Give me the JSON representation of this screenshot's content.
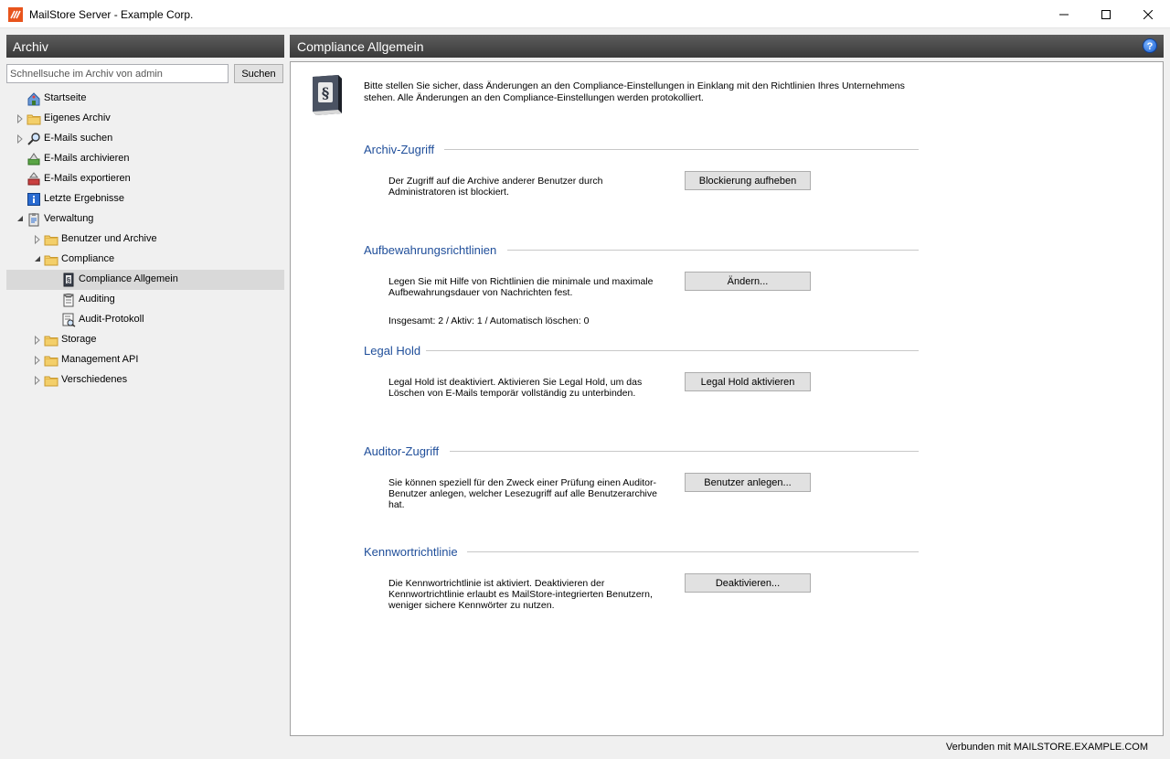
{
  "window": {
    "title": "MailStore Server - Example Corp."
  },
  "left_panel": {
    "header": "Archiv",
    "search": {
      "placeholder": "Schnellsuche im Archiv von admin",
      "button_label": "Suchen"
    },
    "tree": [
      {
        "label": "Startseite",
        "icon": "home-icon",
        "level": 0,
        "expander": "none"
      },
      {
        "label": "Eigenes Archiv",
        "icon": "folder-icon",
        "level": 0,
        "expander": "collapsed"
      },
      {
        "label": "E-Mails suchen",
        "icon": "magnifier-icon",
        "level": 0,
        "expander": "collapsed"
      },
      {
        "label": "E-Mails archivieren",
        "icon": "archive-icon",
        "level": 0,
        "expander": "none"
      },
      {
        "label": "E-Mails exportieren",
        "icon": "export-icon",
        "level": 0,
        "expander": "none"
      },
      {
        "label": "Letzte Ergebnisse",
        "icon": "results-icon",
        "level": 0,
        "expander": "none"
      },
      {
        "label": "Verwaltung",
        "icon": "clipboard-icon",
        "level": 0,
        "expander": "expanded"
      },
      {
        "label": "Benutzer und Archive",
        "icon": "folder-icon",
        "level": 1,
        "expander": "collapsed"
      },
      {
        "label": "Compliance",
        "icon": "folder-icon",
        "level": 1,
        "expander": "expanded"
      },
      {
        "label": "Compliance Allgemein",
        "icon": "law-book-icon",
        "level": 2,
        "expander": "none",
        "selected": true
      },
      {
        "label": "Auditing",
        "icon": "auditing-icon",
        "level": 2,
        "expander": "none"
      },
      {
        "label": "Audit-Protokoll",
        "icon": "audit-log-icon",
        "level": 2,
        "expander": "none"
      },
      {
        "label": "Storage",
        "icon": "folder-icon",
        "level": 1,
        "expander": "collapsed"
      },
      {
        "label": "Management API",
        "icon": "folder-icon",
        "level": 1,
        "expander": "collapsed"
      },
      {
        "label": "Verschiedenes",
        "icon": "folder-icon",
        "level": 1,
        "expander": "collapsed"
      }
    ]
  },
  "right_panel": {
    "header": "Compliance Allgemein",
    "intro": "Bitte stellen Sie sicher, dass Änderungen an den Compliance-Einstellungen in Einklang mit den Richtlinien Ihres Unternehmens stehen. Alle Änderungen an den Compliance-Einstellungen werden protokolliert.",
    "sections": {
      "archive_access": {
        "title": "Archiv-Zugriff",
        "text": "Der Zugriff auf die Archive anderer Benutzer durch Administratoren ist blockiert.",
        "button": "Blockierung aufheben"
      },
      "retention": {
        "title": "Aufbewahrungsrichtlinien",
        "text": "Legen Sie mit Hilfe von Richtlinien die minimale und maximale Aufbewahrungsdauer von Nachrichten fest.",
        "button": "Ändern...",
        "summary": "Insgesamt: 2 / Aktiv: 1 / Automatisch löschen: 0"
      },
      "legal_hold": {
        "title": "Legal Hold",
        "text": "Legal Hold ist deaktiviert. Aktivieren Sie Legal Hold, um das Löschen von E-Mails temporär vollständig zu unterbinden.",
        "button": "Legal Hold aktivieren"
      },
      "auditor_access": {
        "title": "Auditor-Zugriff",
        "text": "Sie können speziell für den Zweck einer Prüfung einen Auditor-Benutzer anlegen, welcher Lesezugriff auf alle Benutzerarchive hat.",
        "button": "Benutzer anlegen..."
      },
      "password_policy": {
        "title": "Kennwortrichtlinie",
        "text": "Die Kennwortrichtlinie ist aktiviert. Deaktivieren der Kennwortrichtlinie erlaubt es MailStore-integrierten Benutzern, weniger sichere Kennwörter zu nutzen.",
        "button": "Deaktivieren..."
      }
    }
  },
  "status_bar": {
    "text": "Verbunden mit MAILSTORE.EXAMPLE.COM"
  },
  "colors": {
    "header_bg": "#4a4a4a",
    "section_title": "#1f4e9a",
    "selected_row": "#d9d9d9"
  }
}
